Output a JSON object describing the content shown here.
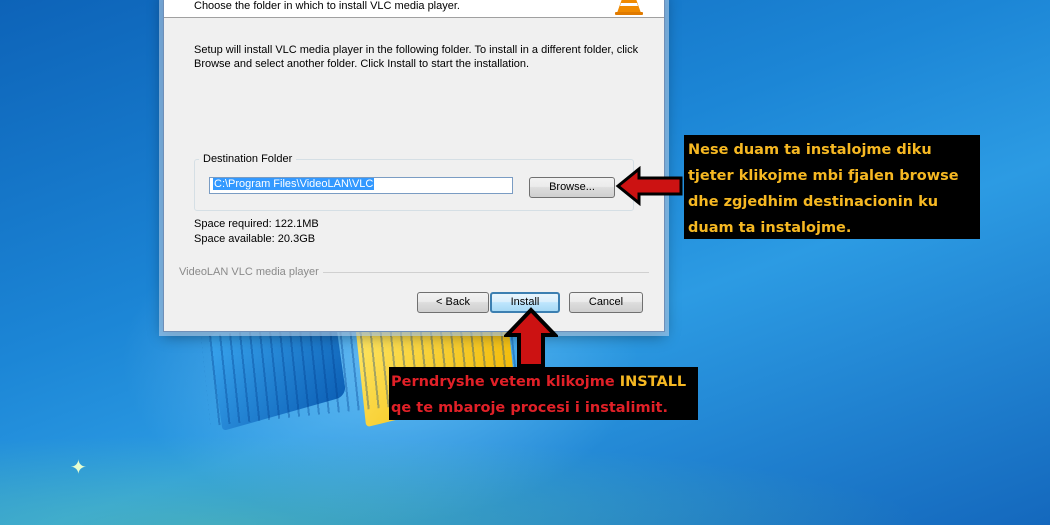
{
  "dialog": {
    "header_subtitle": "Choose the folder in which to install VLC media player.",
    "description": "Setup will install VLC media player in the following folder. To install in a different folder, click Browse and select another folder. Click Install to start the installation.",
    "destination_label": "Destination Folder",
    "destination_value": "C:\\Program Files\\VideoLAN\\VLC",
    "browse_label": "Browse...",
    "space_required": "Space required: 122.1MB",
    "space_available": "Space available: 20.3GB",
    "brand_text": "VideoLAN VLC media player",
    "back_label": "< Back",
    "install_label": "Install",
    "cancel_label": "Cancel"
  },
  "annotations": {
    "top_note": "Nese duam ta instalojme diku tjeter klikojme mbi fjalen browse dhe zgjedhim destinacionin ku duam ta instalojme.",
    "bottom_note_part1": "Perndryshe vetem klikojme ",
    "bottom_note_highlight": "INSTALL",
    "bottom_note_part2": " qe te mbaroje procesi i instalimit."
  },
  "colors": {
    "note_yellow": "#f6b822",
    "note_red": "#e02027",
    "arrow_red": "#cc1212"
  },
  "icons": [
    "vlc-cone-icon",
    "left-arrow-icon",
    "up-arrow-icon"
  ]
}
